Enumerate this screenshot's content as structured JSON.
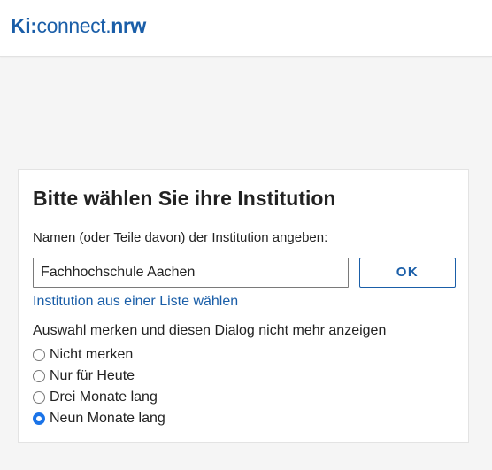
{
  "header": {
    "logo": {
      "part_ki": "Ki",
      "part_colon": ":",
      "part_connect": "connect.",
      "part_nrw": "nrw"
    }
  },
  "dialog": {
    "title": "Bitte wählen Sie ihre Institution",
    "input_label": "Namen (oder Teile davon) der Institution angeben:",
    "input_value": "Fachhochschule Aachen",
    "ok_label": "OK",
    "list_link": "Institution aus einer Liste wählen",
    "remember_label": "Auswahl merken und diesen Dialog nicht mehr anzeigen",
    "options": [
      {
        "label": "Nicht merken",
        "checked": false
      },
      {
        "label": "Nur für Heute",
        "checked": false
      },
      {
        "label": "Drei Monate lang",
        "checked": false
      },
      {
        "label": "Neun Monate lang",
        "checked": true
      }
    ]
  },
  "colors": {
    "brand": "#1a5ea8",
    "radio_checked": "#1a73e8",
    "background": "#f5f5f5"
  }
}
